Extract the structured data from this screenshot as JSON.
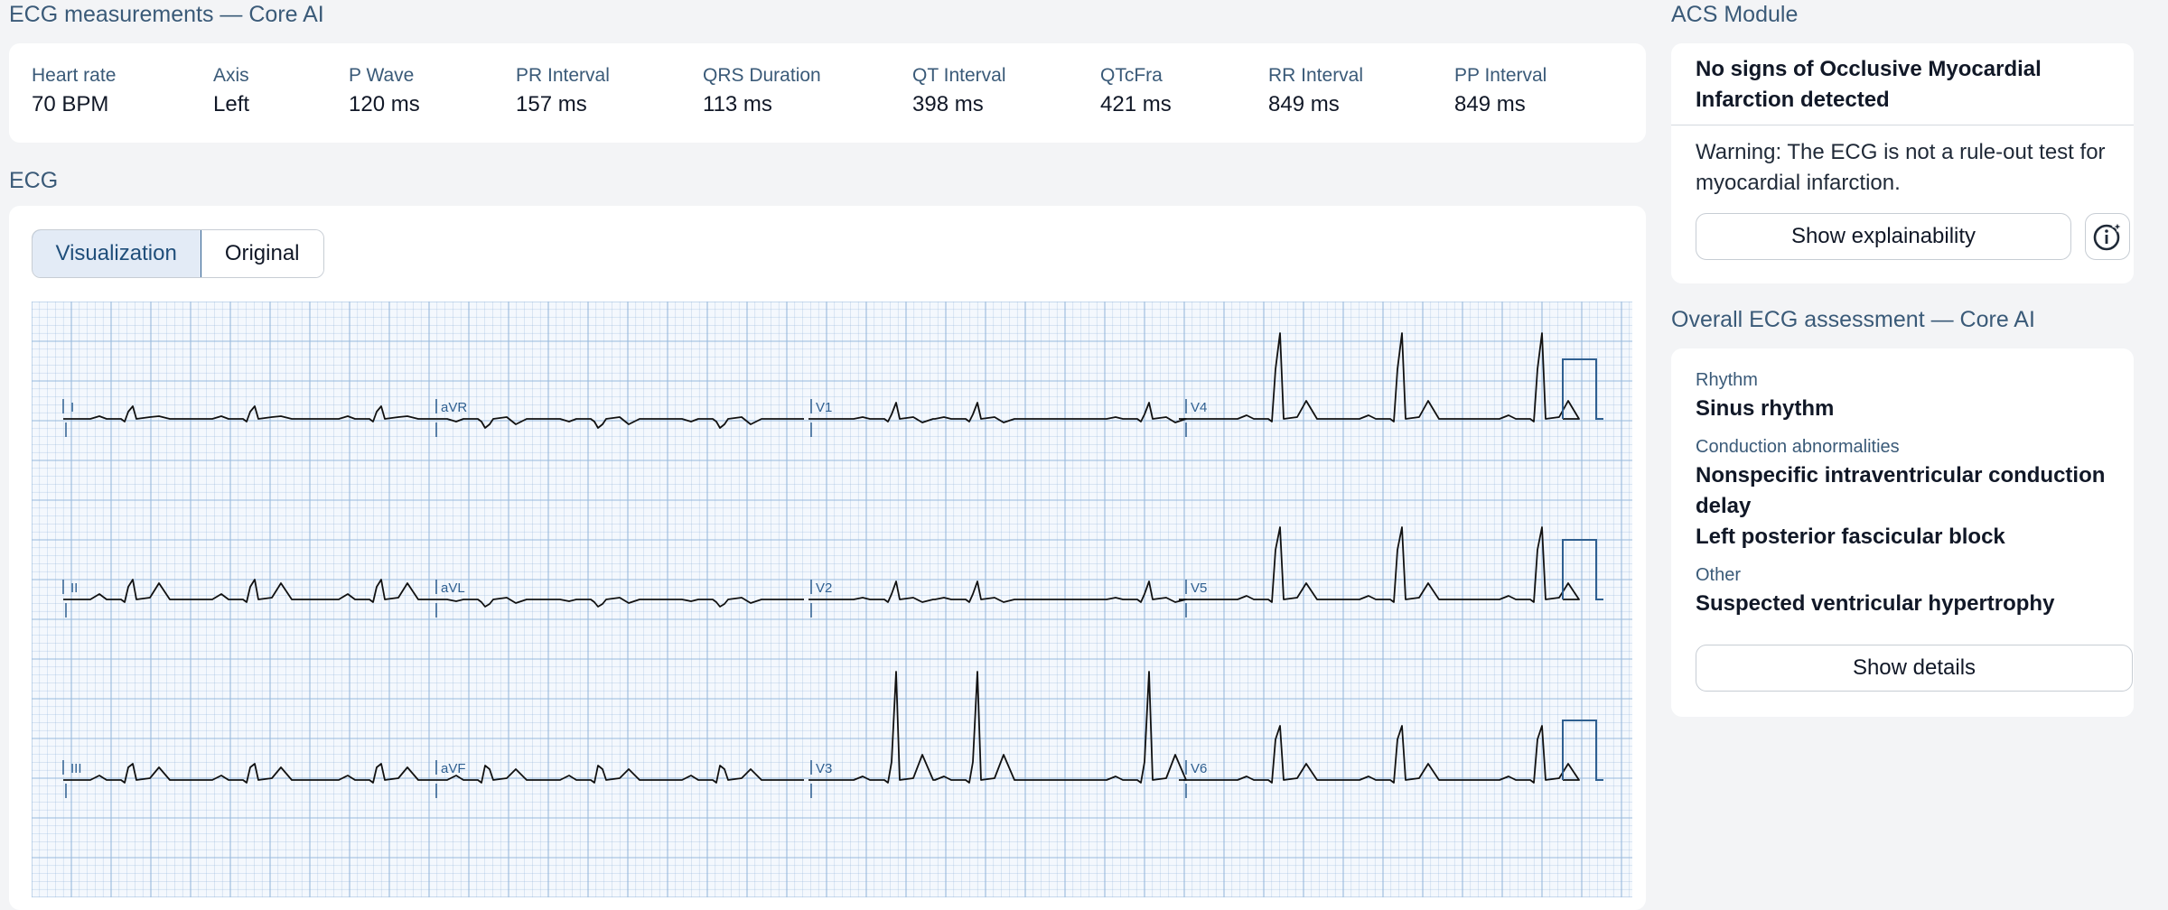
{
  "measurements": {
    "title": "ECG measurements — Core AI",
    "items": [
      {
        "label": "Heart rate",
        "value": "70 BPM"
      },
      {
        "label": "Axis",
        "value": "Left"
      },
      {
        "label": "P Wave",
        "value": "120 ms"
      },
      {
        "label": "PR Interval",
        "value": "157 ms"
      },
      {
        "label": "QRS Duration",
        "value": "113 ms"
      },
      {
        "label": "QT Interval",
        "value": "398 ms"
      },
      {
        "label": "QTcFra",
        "value": "421 ms"
      },
      {
        "label": "RR Interval",
        "value": "849 ms"
      },
      {
        "label": "PP Interval",
        "value": "849 ms"
      }
    ]
  },
  "ecg": {
    "title": "ECG",
    "tabs": {
      "visualization": "Visualization",
      "original": "Original"
    },
    "active_tab": "Visualization",
    "leads": [
      "I",
      "aVR",
      "V1",
      "V4",
      "II",
      "aVL",
      "V2",
      "V5",
      "III",
      "aVF",
      "V3",
      "V6"
    ],
    "grid_color": "#8fb3d9",
    "label_color": "#2f5f90"
  },
  "acs": {
    "title": "ACS Module",
    "result": "No signs of Occlusive Myocardial Infarction detected",
    "warning": "Warning: The ECG is not a rule-out test for myocardial infarction.",
    "explain_button": "Show explainability",
    "info_icon": "info-sparkle-icon"
  },
  "assessment": {
    "title": "Overall ECG assessment — Core AI",
    "rhythm_label": "Rhythm",
    "rhythm_value": "Sinus rhythm",
    "conduction_label": "Conduction abnormalities",
    "conduction_values": [
      "Nonspecific intraventricular conduction delay",
      "Left posterior fascicular block"
    ],
    "other_label": "Other",
    "other_value": "Suspected ventricular hypertrophy",
    "details_button": "Show details"
  }
}
